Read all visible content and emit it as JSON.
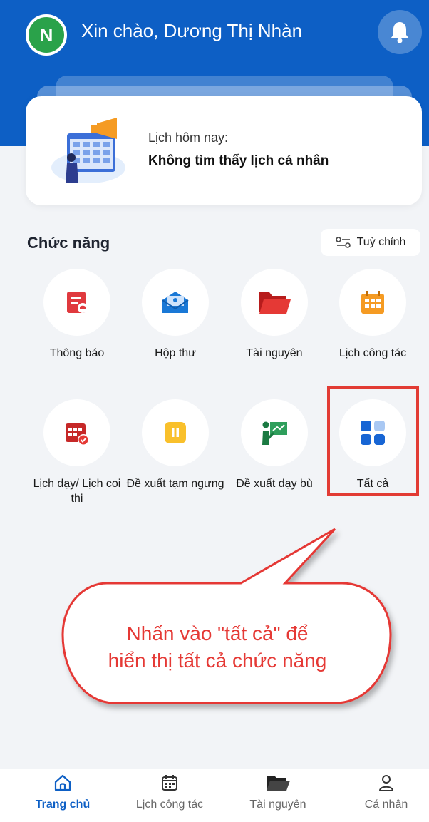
{
  "header": {
    "avatar_initial": "N",
    "greeting": "Xin chào, Dương Thị Nhàn",
    "bell_icon": "bell-icon",
    "accent_color": "#0d5fc5"
  },
  "today": {
    "label": "Lịch hôm nay:",
    "value": "Không tìm thấy lịch cá nhân"
  },
  "functions": {
    "title": "Chức năng",
    "customize_label": "Tuỳ chỉnh",
    "items": [
      {
        "label": "Thông báo",
        "icon": "notification-doc-icon"
      },
      {
        "label": "Hộp thư",
        "icon": "mail-icon"
      },
      {
        "label": "Tài nguyên",
        "icon": "folder-icon"
      },
      {
        "label": "Lịch công tác",
        "icon": "calendar-grid-icon"
      },
      {
        "label": "Lịch dạy/ Lịch coi thi",
        "icon": "calendar-check-icon"
      },
      {
        "label": "Đề xuất tạm ngưng",
        "icon": "pause-icon"
      },
      {
        "label": "Đề xuất dạy bù",
        "icon": "teacher-board-icon"
      },
      {
        "label": "Tất cả",
        "icon": "grid-apps-icon"
      }
    ]
  },
  "callout": {
    "text_line1": "Nhấn vào \"tất cả\" để",
    "text_line2": "hiển thị tất cả chức năng",
    "color": "#e53935"
  },
  "bottom_nav": {
    "items": [
      {
        "label": "Trang chủ",
        "icon": "home-icon",
        "active": true
      },
      {
        "label": "Lịch công tác",
        "icon": "calendar-icon",
        "active": false
      },
      {
        "label": "Tài nguyên",
        "icon": "folder-icon",
        "active": false
      },
      {
        "label": "Cá nhân",
        "icon": "person-icon",
        "active": false
      }
    ]
  }
}
